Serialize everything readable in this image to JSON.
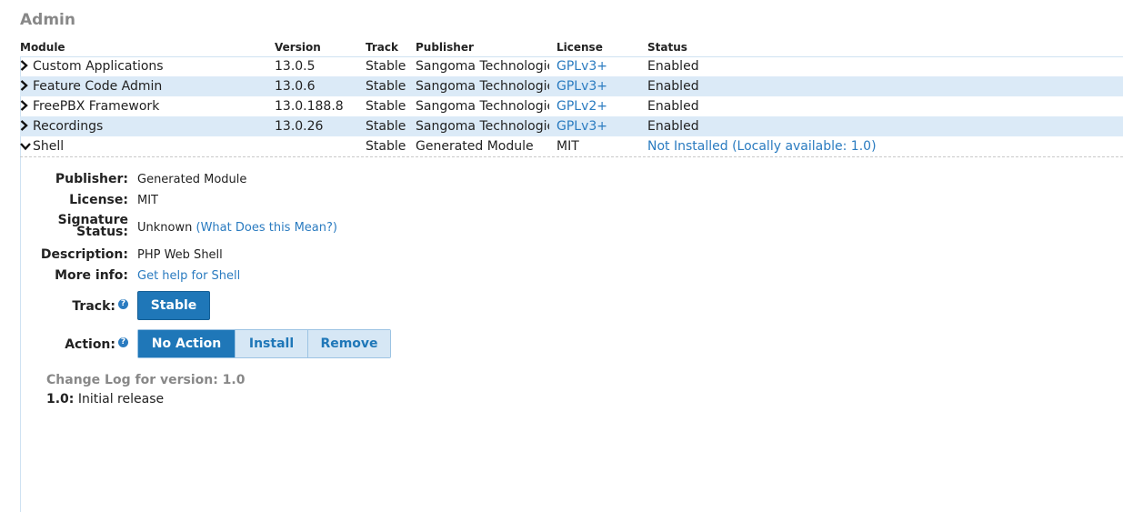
{
  "section": {
    "title": "Admin"
  },
  "table": {
    "headers": {
      "module": "Module",
      "version": "Version",
      "track": "Track",
      "publisher": "Publisher",
      "license": "License",
      "status": "Status"
    },
    "rows": [
      {
        "module": "Custom Applications",
        "version": "13.0.5",
        "track": "Stable",
        "publisher": "Sangoma Technologies",
        "license": "GPLv3+",
        "status": "Enabled"
      },
      {
        "module": "Feature Code Admin",
        "version": "13.0.6",
        "track": "Stable",
        "publisher": "Sangoma Technologies",
        "license": "GPLv3+",
        "status": "Enabled"
      },
      {
        "module": "FreePBX Framework",
        "version": "13.0.188.8",
        "track": "Stable",
        "publisher": "Sangoma Technologies",
        "license": "GPLv2+",
        "status": "Enabled"
      },
      {
        "module": "Recordings",
        "version": "13.0.26",
        "track": "Stable",
        "publisher": "Sangoma Technologies",
        "license": "GPLv3+",
        "status": "Enabled"
      },
      {
        "module": "Shell",
        "version": "",
        "track": "Stable",
        "publisher": "Generated Module",
        "license": "MIT",
        "status": "Not Installed (Locally available: 1.0)"
      }
    ]
  },
  "details": {
    "publisher_label": "Publisher:",
    "publisher_value": "Generated Module",
    "license_label": "License:",
    "license_value": "MIT",
    "signature_label_line1": "Signature",
    "signature_label_line2": "Status:",
    "signature_value": "Unknown",
    "signature_link": "(What Does this Mean?)",
    "description_label": "Description:",
    "description_value": "PHP Web Shell",
    "moreinfo_label": "More info:",
    "moreinfo_link": "Get help for Shell",
    "track_label": "Track:",
    "track_button": "Stable",
    "action_label": "Action:",
    "actions": [
      "No Action",
      "Install",
      "Remove"
    ],
    "changelog_title": "Change Log for version: 1.0",
    "changelog_version": "1.0:",
    "changelog_text": "Initial release"
  },
  "colors": {
    "accent": "#1f77b8",
    "link": "#2a7bc0",
    "row_alt": "#dbeaf7",
    "muted": "#888888"
  },
  "icons": {
    "expand": "chevron-right-icon",
    "collapse": "chevron-down-icon",
    "help": "help-icon"
  }
}
